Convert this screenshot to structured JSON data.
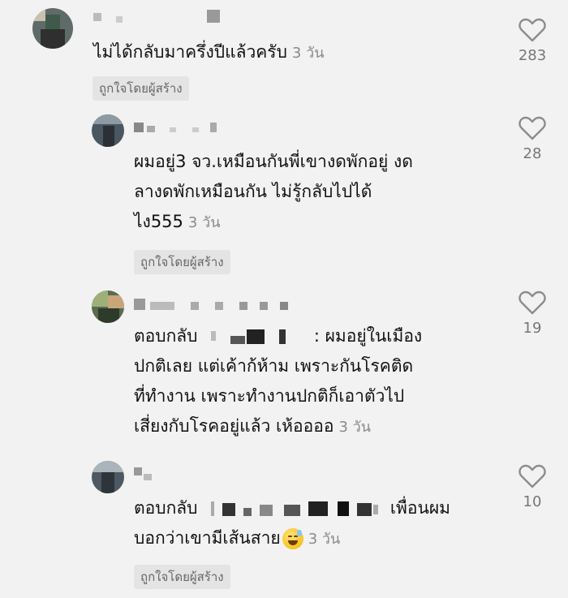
{
  "comments": [
    {
      "text": "ไม่ได้กลับมาครึ่งปีแล้วครับ",
      "time": "3 วัน",
      "badge": "ถูกใจโดยผู้สร้าง",
      "likes": "283"
    },
    {
      "lines": [
        "ผมอยู่3 จว.เหมือนกันพี่เขางดพักอยู่ งด",
        "ลางดพักเหมือนกัน ไม่รู้กลับไปได้",
        "ไง555"
      ],
      "time": "3 วัน",
      "badge": "ถูกใจโดยผู้สร้าง",
      "likes": "28"
    },
    {
      "reply_prefix": "ตอบกลับ",
      "lines": [
        ": ผมอยู่ในเมือง",
        "ปกติเลย แต่เค้าก้ห้าม เพราะกันโรคติด",
        "ที่ทำงาน เพราะทำงานปกติก็เอาตัวไป",
        "เสี่ยงกับโรคอยู่แล้ว เห้ออออ"
      ],
      "time": "3 วัน",
      "likes": "19"
    },
    {
      "reply_prefix": "ตอบกลับ",
      "lines": [
        "เพื่อนผม",
        "บอกว่าเขามีเส้นสาย"
      ],
      "time": "3 วัน",
      "badge": "ถูกใจโดยผู้สร้าง",
      "likes": "10"
    }
  ],
  "icons": {
    "like": "heart-outline-icon",
    "emoji": "grinning-sweat-emoji-icon"
  },
  "colors": {
    "background": "#f2f2f2",
    "text": "#111111",
    "muted": "#8a8a8a",
    "badge_bg": "#e4e4e4"
  }
}
